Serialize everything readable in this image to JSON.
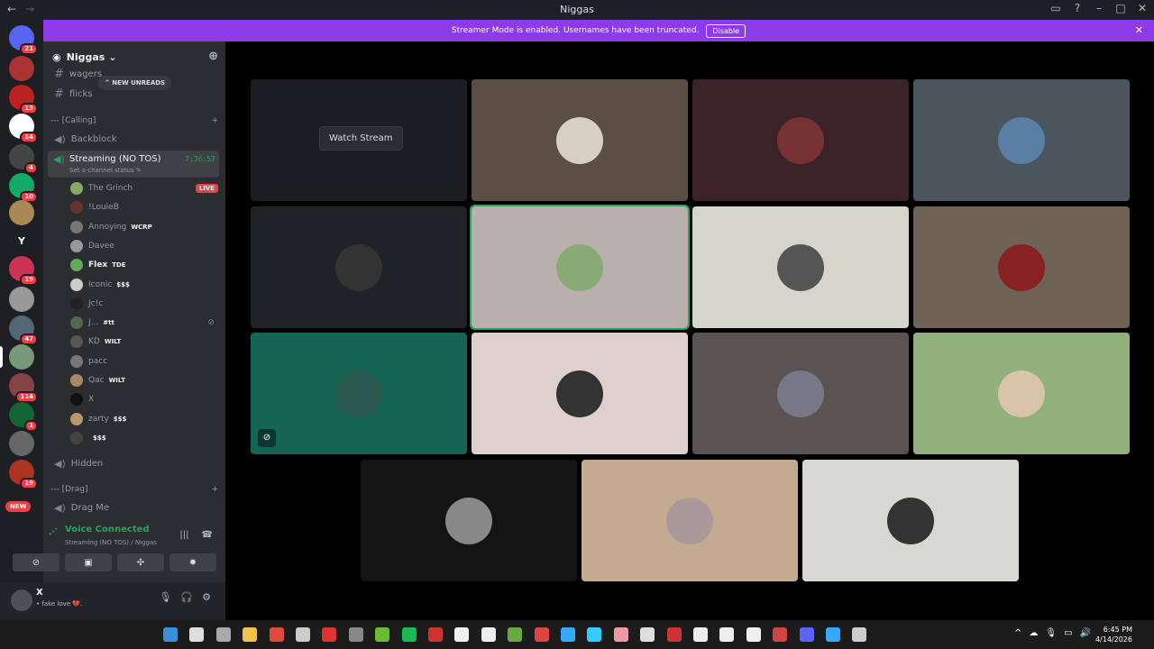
{
  "window": {
    "title": "Niggas",
    "back_arrow": "←",
    "forward_arrow": "→",
    "minimize": "–",
    "maximize": "□",
    "close": "✕",
    "inbox": "▭",
    "help": "?"
  },
  "banner": {
    "text": "Streamer Mode is enabled. Usernames have been truncated.",
    "disable_label": "Disable",
    "close": "✕"
  },
  "guilds": [
    {
      "badge": "21",
      "color": "#5865f2"
    },
    {
      "badge": "",
      "color": "#a33"
    },
    {
      "badge": "13",
      "color": "#b22"
    },
    {
      "badge": "14",
      "color": "#fff"
    },
    {
      "badge": "4",
      "color": "#444"
    },
    {
      "badge": "10",
      "color": "#1a6"
    },
    {
      "badge": "",
      "color": "#a85"
    },
    {
      "badge": "",
      "label": "Y",
      "color": "#1e1f22"
    },
    {
      "badge": "19",
      "color": "#c35"
    },
    {
      "badge": "",
      "color": "#999"
    },
    {
      "badge": "47",
      "color": "#567"
    },
    {
      "badge": "",
      "color": "#797"
    },
    {
      "badge": "114",
      "color": "#844"
    },
    {
      "badge": "1",
      "color": "#163"
    },
    {
      "badge": "",
      "color": "#666"
    },
    {
      "badge": "19",
      "color": "#a32"
    }
  ],
  "new_label": "NEW",
  "server": {
    "name": "Niggas",
    "chevron": "⌄",
    "add_user_icon": "⊕",
    "new_unreads": "^ NEW UNREADS"
  },
  "channels": {
    "text": [
      {
        "name": "wagers"
      },
      {
        "name": "flicks"
      }
    ],
    "category_calling": "--- [Calling]",
    "category_drag": "--- [Drag]",
    "voice": [
      {
        "name": "Backblock"
      },
      {
        "name": "Hidden"
      },
      {
        "name": "Drag Me"
      }
    ],
    "active": {
      "name": "Streaming (NO TOS)",
      "status": "Set a channel status ✎",
      "timer": "7:36:57"
    }
  },
  "voice_users": [
    {
      "name": "The Grinch",
      "tag": "",
      "live": "LIVE",
      "color": "#8a6"
    },
    {
      "name": "!LouieB",
      "tag": "",
      "color": "#633"
    },
    {
      "name": "Annoying",
      "tag": "WCRP",
      "color": "#777"
    },
    {
      "name": "Davee",
      "tag": "",
      "color": "#999"
    },
    {
      "name": "Flex",
      "tag": "TDE",
      "color": "#6a5",
      "bold": true
    },
    {
      "name": "Iconic",
      "tag": "$$$",
      "color": "#ccc"
    },
    {
      "name": "Jc!c",
      "tag": "",
      "color": "#222"
    },
    {
      "name": "J...",
      "tag": "#tt",
      "color": "#565",
      "muted": "⊘"
    },
    {
      "name": "KD",
      "tag": "WILT",
      "color": "#555"
    },
    {
      "name": "pacc",
      "tag": "",
      "color": "#777"
    },
    {
      "name": "Qac",
      "tag": "WILT",
      "color": "#a86"
    },
    {
      "name": "X",
      "tag": "",
      "color": "#111"
    },
    {
      "name": "zarty",
      "tag": "$$$",
      "color": "#b96"
    },
    {
      "name": "",
      "tag": "$$$",
      "color": "#444"
    }
  ],
  "voice_panel": {
    "status": "Voice Connected",
    "location": "Streaming (NO TOS) / Niggas",
    "signal_icon": "📶",
    "noise_icon": "|||",
    "disconnect_icon": "☎",
    "camera_icon": "⊘",
    "screen_icon": "▣",
    "activity_icon": "✣",
    "soundboard_icon": "✸"
  },
  "user_bar": {
    "name": "X",
    "status": "• fake love 💔.",
    "mic_icon": "🎙",
    "headset_icon": "🎧",
    "settings_icon": "⚙"
  },
  "stage": {
    "watch_stream": "Watch Stream",
    "tile_colors": [
      "#1c1d20",
      "#5a4e45",
      "#3a2228",
      "#4b555e",
      "#1f2226",
      "#b9b0ad",
      "#d6d5cc",
      "#6d6253",
      "#146555",
      "#ddd0cd",
      "#595353",
      "#92b07c",
      "#141414",
      "#c4aa90",
      "#d8d8d3"
    ],
    "face_colors": [
      "",
      "#d8d1c3",
      "#733",
      "#5a7fa5",
      "#333",
      "#8a7",
      "#555",
      "#822",
      "#2b5a4f",
      "#333",
      "#778",
      "#d8c4a8",
      "#888",
      "#a99",
      "#333"
    ],
    "muted_icon": "⊘"
  },
  "taskbar": {
    "time": "6:45 PM",
    "date": "4/14/2026",
    "tray": [
      "^",
      "☁",
      "🎙",
      "▭",
      "🔊"
    ]
  }
}
